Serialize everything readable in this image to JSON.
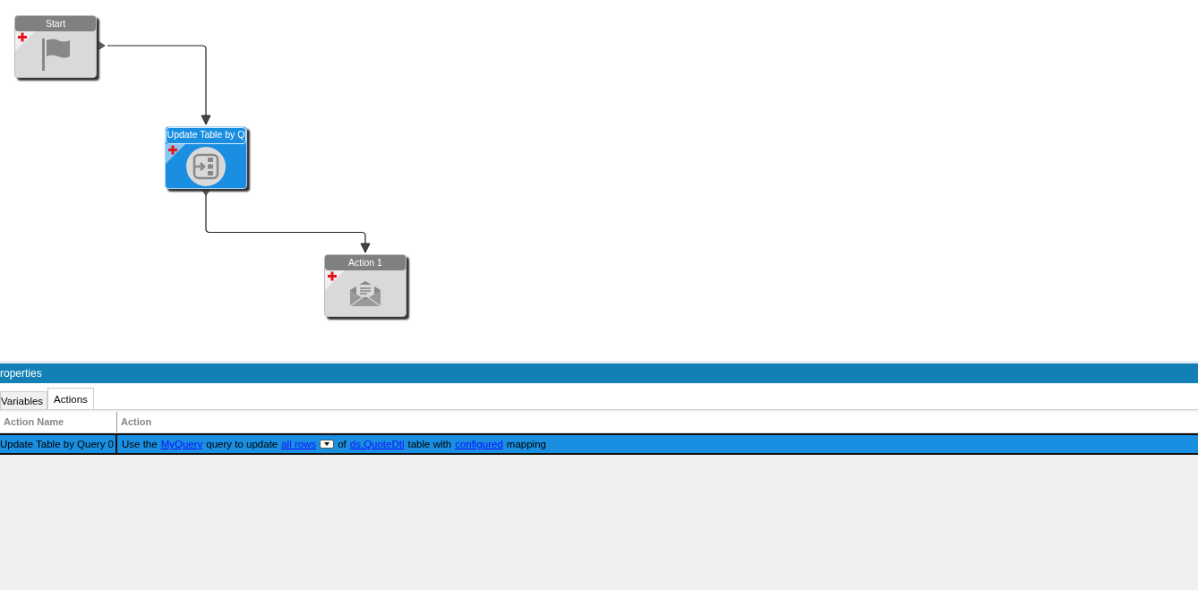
{
  "canvas": {
    "nodes": [
      {
        "title": "Start",
        "kind": "start",
        "selected": false
      },
      {
        "title": "Update Table by Q",
        "kind": "update",
        "selected": true
      },
      {
        "title": "Action 1",
        "kind": "email",
        "selected": false
      }
    ]
  },
  "properties": {
    "title": "roperties",
    "tabs": [
      {
        "label": "Variables",
        "selected": false
      },
      {
        "label": "Actions",
        "selected": true
      }
    ],
    "table": {
      "columns": [
        "Action Name",
        "Action"
      ],
      "rows": [
        {
          "selected": true,
          "name": "Update Table by Query 0",
          "action": [
            {
              "kind": "text",
              "text": "Use the"
            },
            {
              "kind": "link",
              "text": "MyQuery"
            },
            {
              "kind": "text",
              "text": "query to update"
            },
            {
              "kind": "link",
              "text": "all rows"
            },
            {
              "kind": "dropdown"
            },
            {
              "kind": "text",
              "text": "of"
            },
            {
              "kind": "link",
              "text": "ds.QuoteDtl"
            },
            {
              "kind": "text",
              "text": "table with"
            },
            {
              "kind": "link",
              "text": "configured"
            },
            {
              "kind": "text",
              "text": "mapping"
            }
          ]
        }
      ]
    }
  }
}
